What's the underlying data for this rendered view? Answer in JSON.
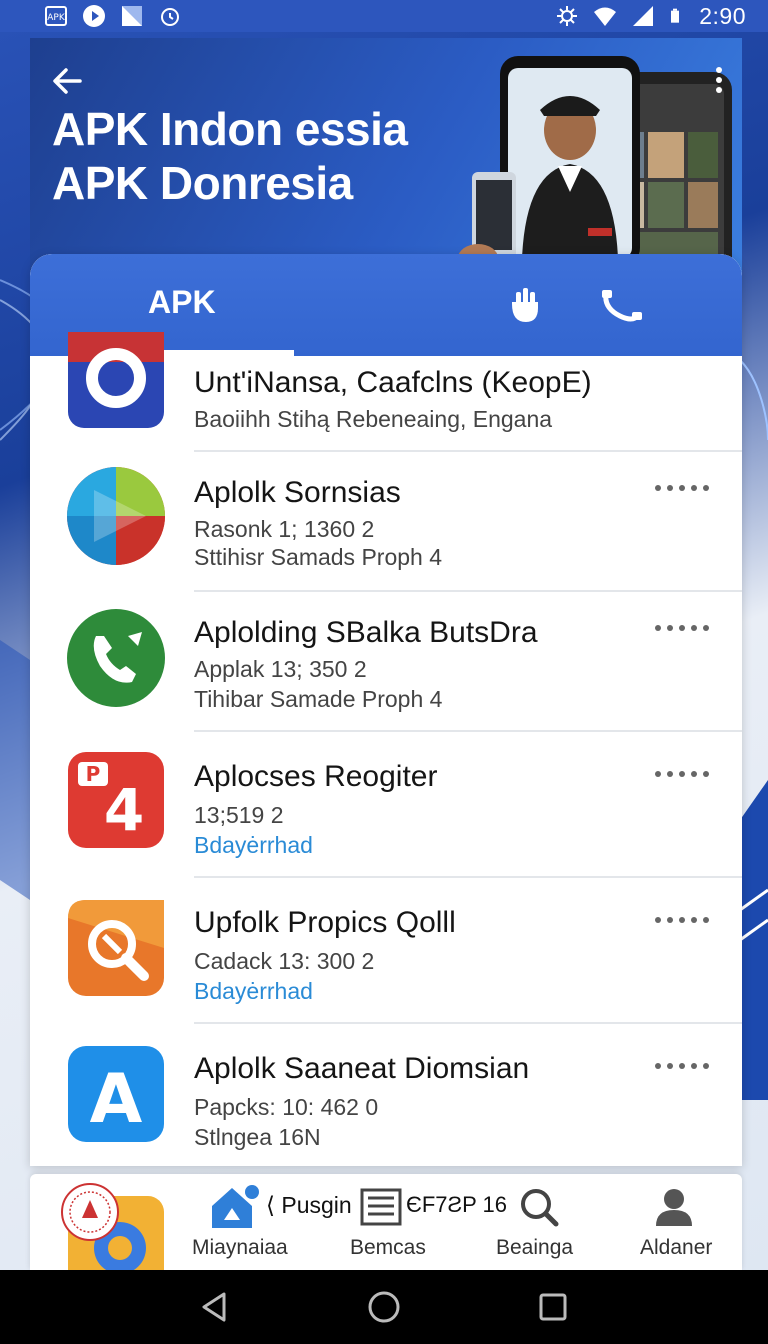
{
  "status_bar": {
    "left_icons": [
      "apk-badge-icon",
      "play-circle-icon",
      "signal-square-icon",
      "alarm-icon"
    ],
    "right_icons": [
      "settings-icon",
      "wifi-icon",
      "cell-signal-icon",
      "battery-icon"
    ],
    "time": "2:90"
  },
  "header": {
    "title_line1": "APK Indon essia",
    "title_line2": "APK Donresia",
    "back_icon": "back-arrow-icon",
    "more_icon": "more-vert-icon"
  },
  "tabs": {
    "active_label": "APK",
    "icon_a": "hand-icon",
    "icon_b": "phone-icon"
  },
  "apps": [
    {
      "title": "Unt'iNansa, Caafclns (KeopE)",
      "line1": "Baoiihh Stihą Rebeneaing, Engana",
      "line2": "",
      "line2_link": false,
      "icon": "camera-ring-app-icon",
      "icon_colors": [
        "#2b46b3",
        "#ffffff"
      ]
    },
    {
      "title": "Aplolk Sornsias",
      "line1": "Rasonk 1; 1360   2",
      "line2": "Sttihisr Samads Proph 4",
      "line2_link": false,
      "icon": "play-triangle-app-icon",
      "icon_colors": [
        "#2aa8e0",
        "#e23b2e"
      ]
    },
    {
      "title": "Aplolding SBalka ButsDra",
      "line1": "Applak 13; 350   2",
      "line2": "Tihibar Samade Proph 4",
      "line2_link": false,
      "icon": "phone-call-app-icon",
      "icon_colors": [
        "#2e8b3a",
        "#ffffff"
      ]
    },
    {
      "title": "Aplocses Reogiter",
      "line1": "13;519   2",
      "line2": "Bdayėrrhad",
      "line2_link": true,
      "icon": "red-p4-app-icon",
      "icon_colors": [
        "#de3a32",
        "#ffffff"
      ]
    },
    {
      "title": "Upfolk Propics Qolll",
      "line1": "Cadack 13: 300   2",
      "line2": "Bdayėrrhad",
      "line2_link": true,
      "icon": "magnifier-tool-app-icon",
      "icon_colors": [
        "#e8772a",
        "#ffffff"
      ]
    },
    {
      "title": "Aplolk Saaneat Diomsian",
      "line1": "Papcks: 10: 462   0",
      "line2": "Stlngea 16N",
      "line2_link": false,
      "icon": "letter-a-app-icon",
      "icon_colors": [
        "#1f8fe8",
        "#ffffff"
      ]
    }
  ],
  "bottom_nav": {
    "items": [
      {
        "label": "",
        "extra": "",
        "icon": "app-logo-icon"
      },
      {
        "label": "Miaynaiaa",
        "extra": "⟨ Pusgin",
        "icon": "upload-home-icon"
      },
      {
        "label": "Bemcas",
        "extra": "ЄF7ƧP 16",
        "icon": "list-grid-icon"
      },
      {
        "label": "Beainga",
        "extra": "",
        "icon": "search-icon"
      },
      {
        "label": "Aldaner",
        "extra": "",
        "icon": "account-icon"
      }
    ]
  },
  "system_nav": {
    "back": "nav-back-icon",
    "home": "nav-home-icon",
    "recents": "nav-recents-icon"
  }
}
